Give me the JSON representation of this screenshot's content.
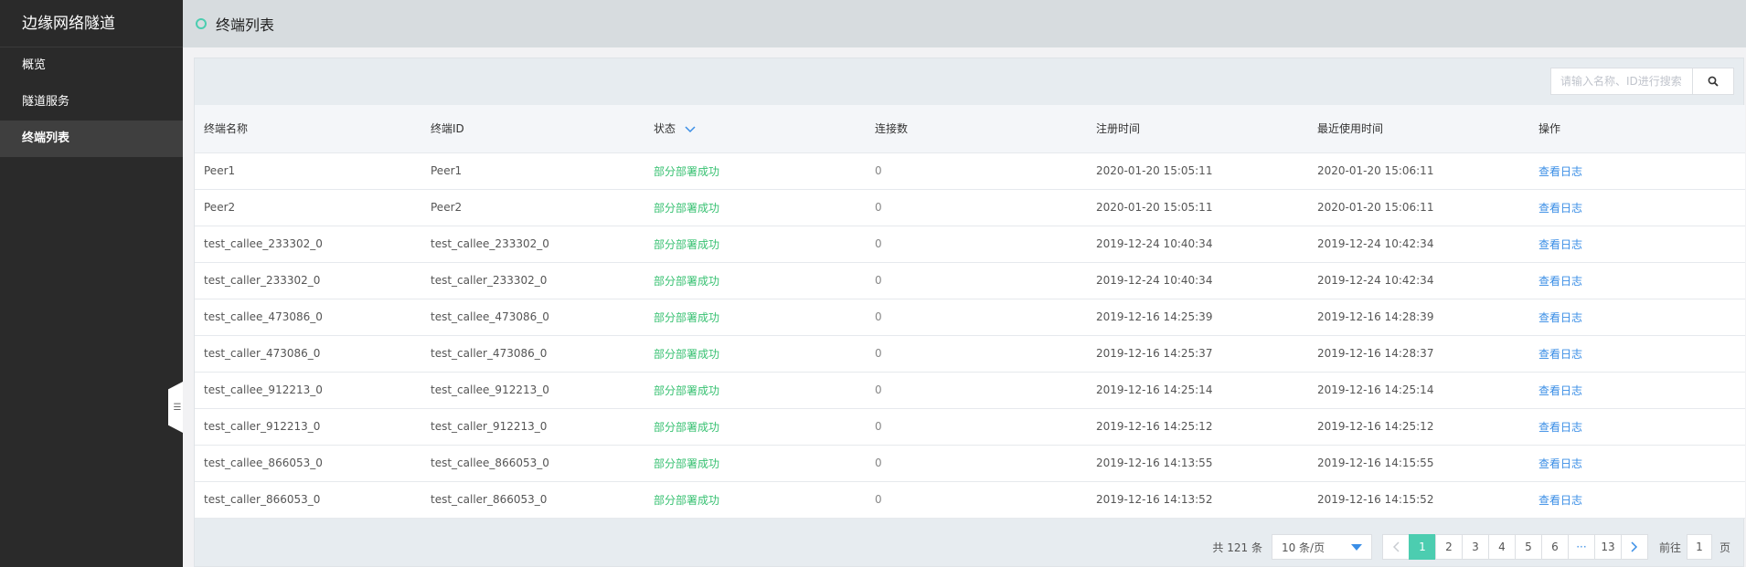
{
  "app": {
    "title": "边缘网络隧道"
  },
  "sidebar": {
    "items": [
      {
        "label": "概览"
      },
      {
        "label": "隧道服务"
      },
      {
        "label": "终端列表"
      }
    ]
  },
  "page": {
    "title": "终端列表"
  },
  "search": {
    "placeholder": "请输入名称、ID进行搜索"
  },
  "table": {
    "headers": {
      "name": "终端名称",
      "id": "终端ID",
      "status": "状态",
      "connections": "连接数",
      "registered": "注册时间",
      "last_used": "最近使用时间",
      "actions": "操作"
    },
    "rows": [
      {
        "name": "Peer1",
        "id": "Peer1",
        "status": "部分部署成功",
        "connections": "0",
        "registered": "2020-01-20 15:05:11",
        "last_used": "2020-01-20 15:06:11",
        "action": "查看日志"
      },
      {
        "name": "Peer2",
        "id": "Peer2",
        "status": "部分部署成功",
        "connections": "0",
        "registered": "2020-01-20 15:05:11",
        "last_used": "2020-01-20 15:06:11",
        "action": "查看日志"
      },
      {
        "name": "test_callee_233302_0",
        "id": "test_callee_233302_0",
        "status": "部分部署成功",
        "connections": "0",
        "registered": "2019-12-24 10:40:34",
        "last_used": "2019-12-24 10:42:34",
        "action": "查看日志"
      },
      {
        "name": "test_caller_233302_0",
        "id": "test_caller_233302_0",
        "status": "部分部署成功",
        "connections": "0",
        "registered": "2019-12-24 10:40:34",
        "last_used": "2019-12-24 10:42:34",
        "action": "查看日志"
      },
      {
        "name": "test_callee_473086_0",
        "id": "test_callee_473086_0",
        "status": "部分部署成功",
        "connections": "0",
        "registered": "2019-12-16 14:25:39",
        "last_used": "2019-12-16 14:28:39",
        "action": "查看日志"
      },
      {
        "name": "test_caller_473086_0",
        "id": "test_caller_473086_0",
        "status": "部分部署成功",
        "connections": "0",
        "registered": "2019-12-16 14:25:37",
        "last_used": "2019-12-16 14:28:37",
        "action": "查看日志"
      },
      {
        "name": "test_callee_912213_0",
        "id": "test_callee_912213_0",
        "status": "部分部署成功",
        "connections": "0",
        "registered": "2019-12-16 14:25:14",
        "last_used": "2019-12-16 14:25:14",
        "action": "查看日志"
      },
      {
        "name": "test_caller_912213_0",
        "id": "test_caller_912213_0",
        "status": "部分部署成功",
        "connections": "0",
        "registered": "2019-12-16 14:25:12",
        "last_used": "2019-12-16 14:25:12",
        "action": "查看日志"
      },
      {
        "name": "test_callee_866053_0",
        "id": "test_callee_866053_0",
        "status": "部分部署成功",
        "connections": "0",
        "registered": "2019-12-16 14:13:55",
        "last_used": "2019-12-16 14:15:55",
        "action": "查看日志"
      },
      {
        "name": "test_caller_866053_0",
        "id": "test_caller_866053_0",
        "status": "部分部署成功",
        "connections": "0",
        "registered": "2019-12-16 14:13:52",
        "last_used": "2019-12-16 14:15:52",
        "action": "查看日志"
      }
    ]
  },
  "pagination": {
    "total": "共 121 条",
    "page_size": "10 条/页",
    "pages": [
      "1",
      "2",
      "3",
      "4",
      "5",
      "6"
    ],
    "ellipsis": "···",
    "last_page": "13",
    "goto_label": "前往",
    "goto_value": "1",
    "goto_suffix": "页"
  },
  "colors": {
    "accent": "#4ccdb0",
    "status_success": "#38c172",
    "link": "#3a8ee6",
    "sidebar_bg": "#2a2a2a"
  },
  "icons": {
    "header_dot": "circle-outline-icon",
    "search": "search-icon",
    "sort": "chevron-down-icon",
    "prev": "chevron-left-icon",
    "next": "chevron-right-icon",
    "collapse": "collapse-sidebar-icon"
  }
}
